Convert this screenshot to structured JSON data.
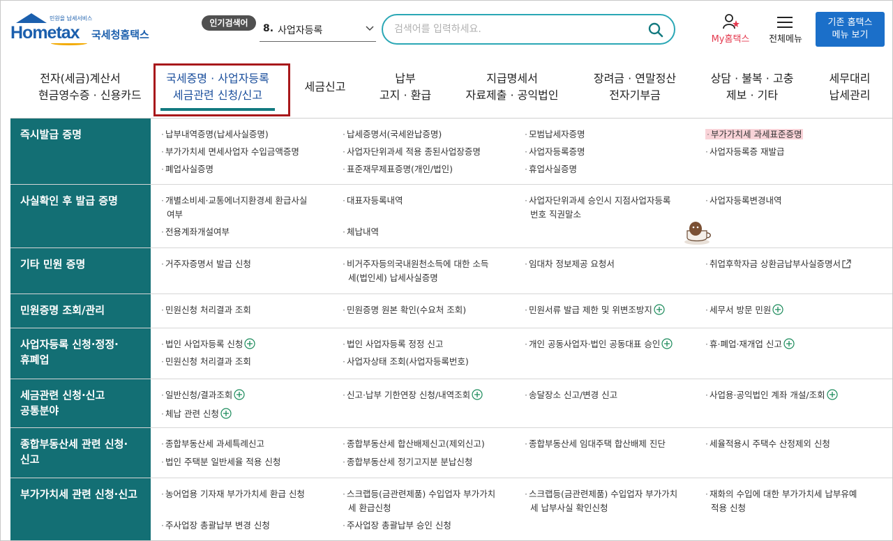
{
  "header": {
    "logo_tag": "민원을 납세서비스",
    "logo_main": "Hometax",
    "logo_sub": "국세청홈택스",
    "popular_badge": "인기검색어",
    "popular_rank": "8.",
    "popular_term": "사업자등록",
    "search_placeholder": "검색어를 입력하세요.",
    "my_label": "My홈택스",
    "menu_label": "전체메뉴",
    "old_menu_line1": "기존 홈택스",
    "old_menu_line2": "메뉴 보기"
  },
  "nav": [
    {
      "line1": "전자(세금)계산서",
      "line2": "현금영수증 · 신용카드"
    },
    {
      "line1": "국세증명 · 사업자등록",
      "line2": "세금관련 신청/신고"
    },
    {
      "line1": "세금신고",
      "line2": ""
    },
    {
      "line1": "납부",
      "line2": "고지 · 환급"
    },
    {
      "line1": "지급명세서",
      "line2": "자료제출 · 공익법인"
    },
    {
      "line1": "장려금 · 연말정산",
      "line2": "전자기부금"
    },
    {
      "line1": "상담 · 불복 · 고충",
      "line2": "제보 · 기타"
    },
    {
      "line1": "세무대리",
      "line2": "납세관리"
    }
  ],
  "sections": [
    {
      "title": "즉시발급 증명",
      "items": [
        "납부내역증명(납세사실증명)",
        "납세증명서(국세완납증명)",
        "모범납세자증명",
        "부가가치세 과세표준증명",
        "부가가치세 면세사업자 수입금액증명",
        "사업자단위과세 적용 종된사업장증명",
        "사업자등록증명",
        "사업자등록증 재발급",
        "폐업사실증명",
        "표준재무제표증명(개인/법인)",
        "휴업사실증명"
      ]
    },
    {
      "title": "사실확인 후 발급 증명",
      "items": [
        "개별소비세·교통에너지환경세 환급사실",
        "여부",
        "대표자등록내역",
        "사업자단위과세 승인시 지점사업자등록",
        "번호 직권말소",
        "사업자등록변경내역",
        "전용계좌개설여부",
        "체납내역"
      ]
    },
    {
      "title": "기타 민원 증명",
      "items": [
        "거주자증명서 발급 신청",
        "비거주자등의국내원천소득에 대한 소득",
        "세(법인세) 납세사실증명",
        "임대차 정보제공 요청서",
        "취업후학자금 상환금납부사실증명서"
      ]
    },
    {
      "title": "민원증명 조회/관리",
      "items": [
        "민원신청 처리결과 조회",
        "민원증명 원본 확인(수요처 조회)",
        "민원서류 발급 제한 및 위변조방지",
        "세무서 방문 민원"
      ]
    },
    {
      "title_line1": "사업자등록 신청·정정·",
      "title_line2": "휴폐업",
      "items": [
        "법인 사업자등록 신청",
        "법인 사업자등록 정정 신고",
        "개인 공동사업자·법인 공동대표 승인",
        "휴·폐업·재개업 신고",
        "민원신청 처리결과 조회",
        "사업자상태 조회(사업자등록번호)"
      ]
    },
    {
      "title_line1": "세금관련 신청·신고",
      "title_line2": "공통분야",
      "items": [
        "일반신청/결과조회",
        "신고·납부 기한연장 신청/내역조회",
        "송달장소 신고/변경 신고",
        "사업용·공익법인 계좌 개설/조회",
        "체납 관련 신청"
      ]
    },
    {
      "title_line1": "종합부동산세 관련 신청·",
      "title_line2": "신고",
      "items": [
        "종합부동산세 과세특례신고",
        "종합부동산세 합산배제신고(제외신고)",
        "종합부동산세 임대주택 합산배제 진단",
        "세율적용시 주택수 산정제외 신청",
        "법인 주택분 일반세율 적용 신청",
        "종합부동산세 정기고지분 분납신청"
      ]
    },
    {
      "title": "부가가치세 관련 신청·신고",
      "items": [
        "농어업용 기자재 부가가치세 환급 신청",
        "스크랩등(금관련제품) 수입업자 부가가치",
        "세 환급신청",
        "스크랩등(금관련제품) 수입업자 부가가치",
        "세 납부사실 확인신청",
        "재화의 수입에 대한 부가가치세 납부유예",
        "적용 신청",
        "주사업장 총괄납부 변경 신청",
        "주사업장 총괄납부 승인 신청"
      ]
    }
  ]
}
